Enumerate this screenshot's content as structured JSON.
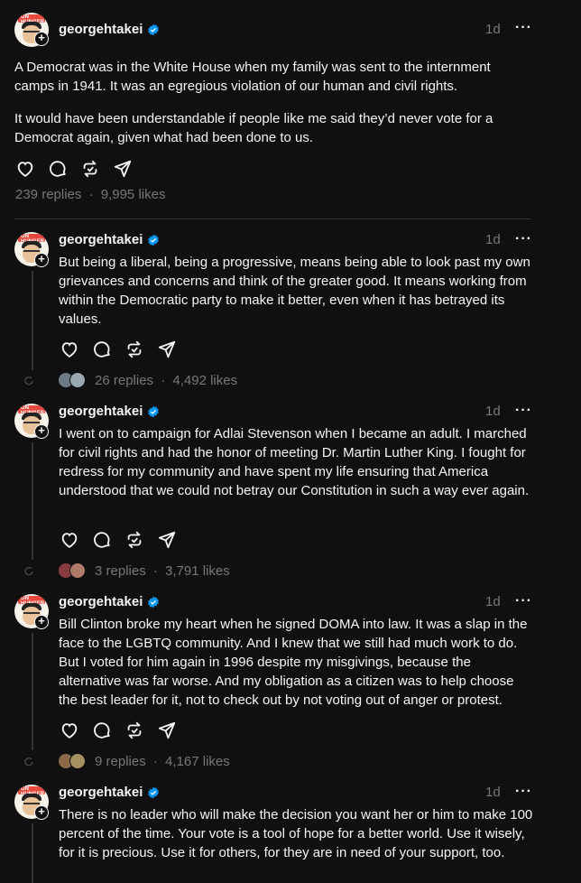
{
  "colors": {
    "background": "#101010",
    "text": "#f3f5f7",
    "muted": "#777777",
    "verified": "#0095f6"
  },
  "posts": [
    {
      "username": "georgehtakei",
      "time": "1d",
      "paragraphs": [
        "A Democrat was in the White House when my family was sent to the internment camps in 1941. It was an egregious violation of our human and civil rights.",
        "It would have been understandable if people like me said they’d never vote for a Democrat again, given what had been done to us."
      ],
      "replies": "239 replies",
      "likes": "9,995 likes"
    },
    {
      "username": "georgehtakei",
      "time": "1d",
      "paragraphs": [
        "But being a liberal, being a progressive, means being able to look past my own grievances and concerns and think of the greater good. It means working from within the Democratic party to make it better, even when it has betrayed its values."
      ],
      "replies": "26 replies",
      "likes": "4,492 likes"
    },
    {
      "username": "georgehtakei",
      "time": "1d",
      "paragraphs": [
        "I went on to campaign for Adlai Stevenson when I became an adult. I marched for civil rights and had the honor of meeting Dr. Martin Luther King. I fought for redress for my community and have spent my life ensuring that America understood that we could not betray our Constitution in such a way ever again."
      ],
      "replies": "3 replies",
      "likes": "3,791 likes"
    },
    {
      "username": "georgehtakei",
      "time": "1d",
      "paragraphs": [
        "Bill Clinton broke my heart when he signed DOMA into law. It was a slap in the face to the LGBTQ community. And I knew that we still had much work to do. But I voted for him again in 1996 despite my misgivings, because the alternative was far worse. And my obligation as a citizen was to help choose the best leader for it, not to check out by not voting out of anger or protest."
      ],
      "replies": "9 replies",
      "likes": "4,167 likes"
    },
    {
      "username": "georgehtakei",
      "time": "1d",
      "paragraphs": [
        "There is no leader who will make the decision you want her or him to make 100 percent of the time. Your vote is a tool of hope for a better world. Use it wisely, for it is precious. Use it for others, for they are in need of your support, too."
      ]
    }
  ],
  "separator": "·",
  "icons": [
    "heart-icon",
    "comment-icon",
    "repost-icon",
    "share-icon",
    "more-icon",
    "verified-icon",
    "follow-plus-icon"
  ]
}
